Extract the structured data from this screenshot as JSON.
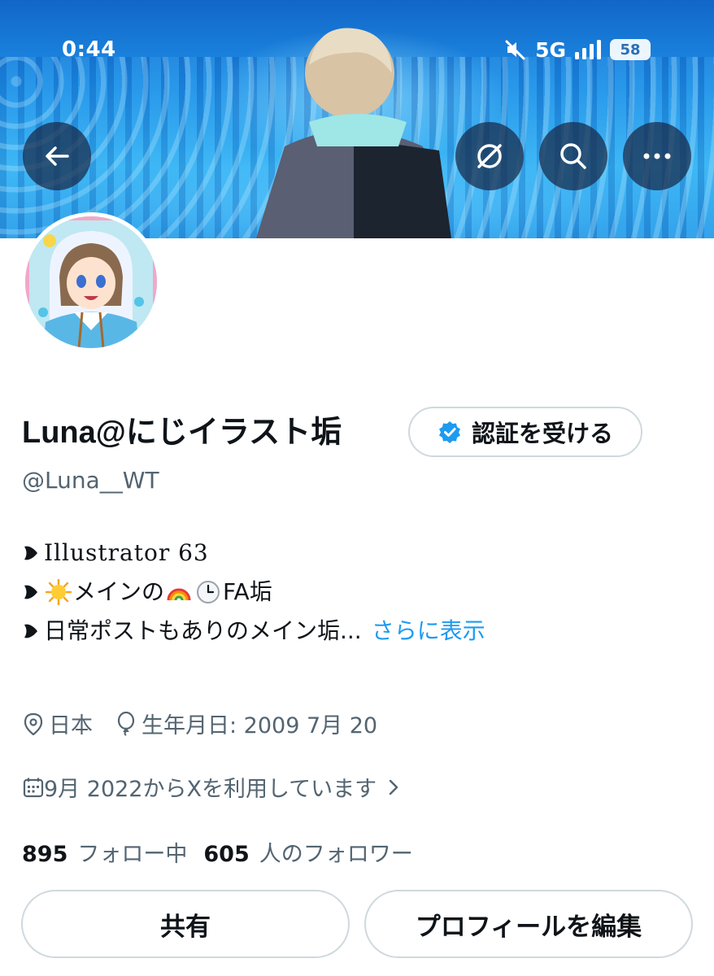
{
  "status_bar": {
    "time": "0:44",
    "network": "5G",
    "battery": "58",
    "icons": [
      "mute-icon",
      "signal-icon",
      "battery-icon"
    ]
  },
  "header": {
    "back_icon": "arrow-left-icon",
    "actions": [
      "grok-icon",
      "search-icon",
      "more-icon"
    ]
  },
  "profile": {
    "display_name": "Luna@にじイラスト垢",
    "verify_button": "認証を受ける",
    "handle": "@Luna__WT",
    "bio": {
      "line1": "Illustrator 63",
      "line2_text": "メインの",
      "line2_suffix": "FA垢",
      "line3_text": "日常ポストもありのメイン垢...",
      "show_more": "さらに表示"
    },
    "location": "日本",
    "birthday": "生年月日: 2009 7月 20",
    "joined": "9月 2022からXを利用しています"
  },
  "stats": {
    "following_count": "895",
    "following_label": "フォロー中",
    "followers_count": "605",
    "followers_label": "人のフォロワー"
  },
  "buttons": {
    "share": "共有",
    "edit_profile": "プロフィールを編集"
  },
  "colors": {
    "link": "#1d9bf0",
    "muted_text": "#536471",
    "verified": "#1d9bf0"
  }
}
